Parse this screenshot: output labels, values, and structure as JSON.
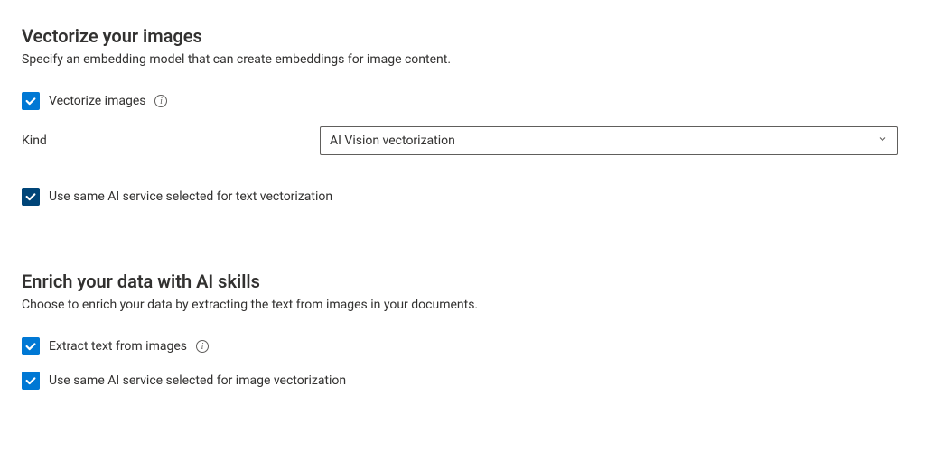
{
  "section1": {
    "title": "Vectorize your images",
    "desc": "Specify an embedding model that can create embeddings for image content.",
    "checkbox_label": "Vectorize images",
    "kind_label": "Kind",
    "kind_value": "AI Vision vectorization",
    "same_service_label": "Use same AI service selected for text vectorization"
  },
  "section2": {
    "title": "Enrich your data with AI skills",
    "desc": "Choose to enrich your data by extracting the text from images in your documents.",
    "extract_label": "Extract text from images",
    "same_service_label": "Use same AI service selected for image vectorization"
  }
}
